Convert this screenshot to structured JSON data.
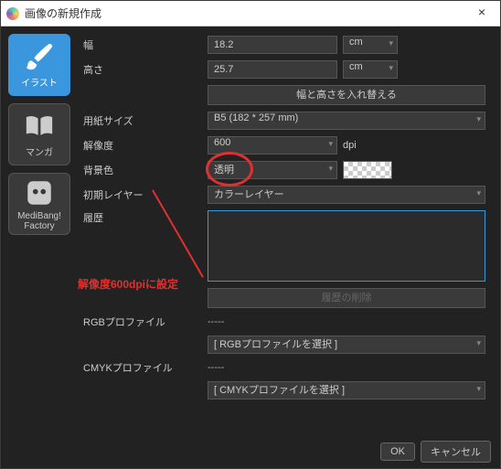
{
  "titlebar": {
    "title": "画像の新規作成",
    "close": "×"
  },
  "sidebar": {
    "tabs": [
      {
        "label": "イラスト"
      },
      {
        "label": "マンガ"
      },
      {
        "label": "MediBang!\nFactory"
      }
    ]
  },
  "form": {
    "width_label": "幅",
    "width_value": "18.2",
    "width_unit": "cm",
    "height_label": "高さ",
    "height_value": "25.7",
    "height_unit": "cm",
    "swap_btn": "幅と高さを入れ替える",
    "papersize_label": "用紙サイズ",
    "papersize_value": "B5 (182 * 257 mm)",
    "dpi_label": "解像度",
    "dpi_value": "600",
    "dpi_unit": "dpi",
    "bg_label": "背景色",
    "bg_value": "透明",
    "layer_label": "初期レイヤー",
    "layer_value": "カラーレイヤー",
    "history_label": "履歴",
    "history_delete": "履歴の削除",
    "rgb_label": "RGBプロファイル",
    "rgb_dash": "-----",
    "rgb_select": "[ RGBプロファイルを選択 ]",
    "cmyk_label": "CMYKプロファイル",
    "cmyk_dash": "-----",
    "cmyk_select": "[ CMYKプロファイルを選択 ]"
  },
  "footer": {
    "ok": "OK",
    "cancel": "キャンセル"
  },
  "annotation": {
    "text": "解像度600dpiに設定"
  }
}
